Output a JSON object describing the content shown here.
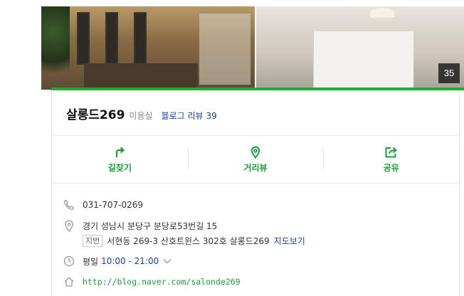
{
  "gallery": {
    "photo_count": "35"
  },
  "place": {
    "name": "살롱드269",
    "category": "미용실",
    "blog_review_label": "블로그 리뷰",
    "blog_review_count": "39"
  },
  "actions": [
    {
      "label": "길찾기",
      "icon": "directions-icon"
    },
    {
      "label": "거리뷰",
      "icon": "street-view-icon"
    },
    {
      "label": "공유",
      "icon": "share-icon"
    }
  ],
  "info": {
    "phone": "031-707-0269",
    "address": "경기 성남시 분당구 분당로53번길 15",
    "jibun_tag": "지번",
    "jibun_address": "서현동 269-3 산호트윈스 302호 살롱드269",
    "map_link": "지도보기",
    "hours_day": "평일",
    "hours_time": "10:00 - 21:00",
    "homepage": "http://blog.naver.com/salonde269"
  },
  "colors": {
    "accent_green": "#17b12b",
    "link_blue": "#1a3fa8"
  }
}
